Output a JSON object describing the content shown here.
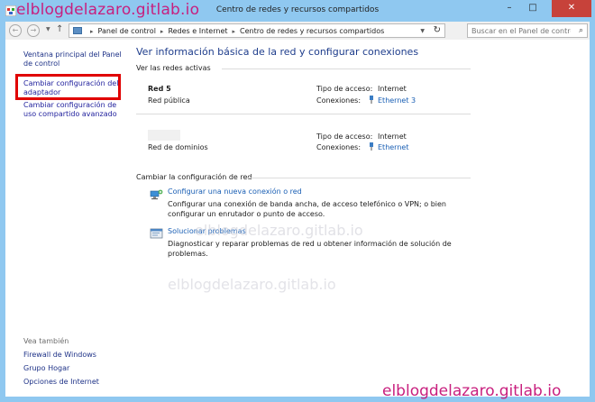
{
  "window": {
    "title": "Centro de redes y recursos compartidos",
    "watermark": "elblogdelazaro.gitlab.io"
  },
  "navbar": {
    "breadcrumbs": [
      "Panel de control",
      "Redes e Internet",
      "Centro de redes y recursos compartidos"
    ],
    "search_placeholder": "Buscar en el Panel de control"
  },
  "leftpane": {
    "links": [
      "Ventana principal del Panel de control",
      "Cambiar configuración del adaptador",
      "Cambiar configuración de uso compartido avanzado"
    ],
    "see_also_title": "Vea también",
    "see_also": [
      "Firewall de Windows",
      "Grupo Hogar",
      "Opciones de Internet"
    ]
  },
  "main": {
    "title": "Ver información básica de la red y configurar conexiones",
    "active_networks_label": "Ver las redes activas",
    "networks": [
      {
        "name": "Red 5",
        "type": "Red pública",
        "access_label": "Tipo de acceso:",
        "access_value": "Internet",
        "connections_label": "Conexiones:",
        "connection": "Ethernet 3"
      },
      {
        "name": "",
        "type": "Red de dominios",
        "access_label": "Tipo de acceso:",
        "access_value": "Internet",
        "connections_label": "Conexiones:",
        "connection": "Ethernet"
      }
    ],
    "change_label": "Cambiar la configuración de red",
    "tasks": [
      {
        "title": "Configurar una nueva conexión o red",
        "description": "Configurar una conexión de banda ancha, de acceso telefónico o VPN; o bien configurar un enrutador o punto de acceso.",
        "icon": "network-setup-icon"
      },
      {
        "title": "Solucionar problemas",
        "description": "Diagnosticar y reparar problemas de red u obtener información de solución de problemas.",
        "icon": "troubleshoot-icon"
      }
    ]
  },
  "colors": {
    "frame": "#8fc8f0",
    "link": "#1a5fb4",
    "highlight_box": "#e00000",
    "watermark": "#c81f7e"
  }
}
